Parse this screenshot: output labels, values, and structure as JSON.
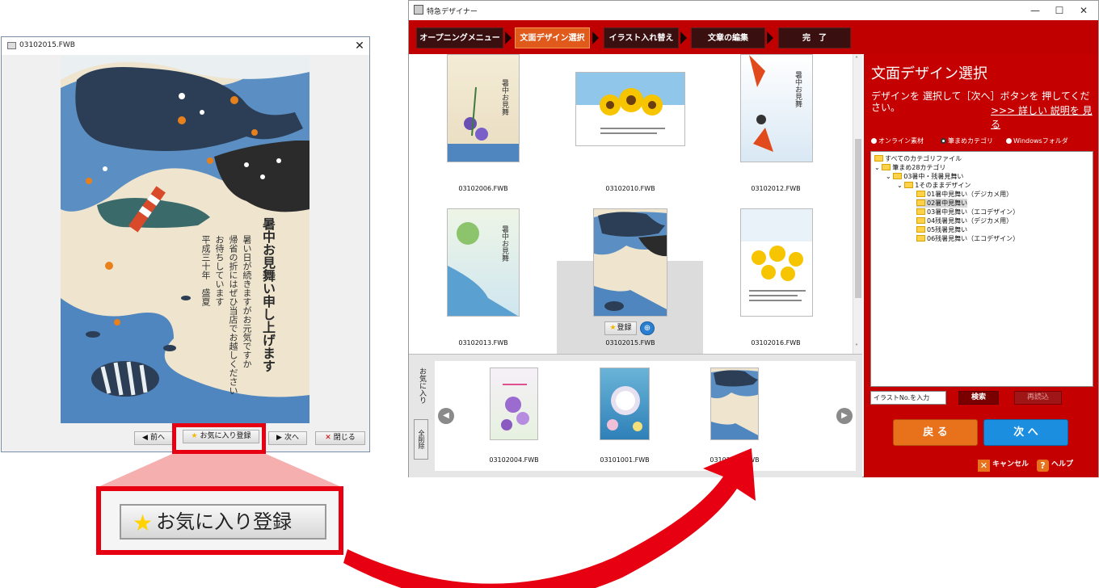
{
  "preview": {
    "title": "03102015.FWB",
    "close": "✕",
    "card_text": {
      "heading": "暑中お見舞い申し上げます",
      "body": [
        "暑い日が続きますがお元気ですか",
        "帰省の折にはぜひ当店でお越しください",
        "お待ちしています"
      ],
      "date": "平成三十年　盛夏"
    },
    "buttons": {
      "prev": "前へ",
      "favorite": "お気に入り登録",
      "next": "次へ",
      "close": "閉じる"
    }
  },
  "callout": {
    "label": "お気に入り登録"
  },
  "app": {
    "title": "特急デザイナー",
    "window_controls": {
      "minimize": "—",
      "maximize": "☐",
      "close": "✕"
    },
    "steps": [
      {
        "label": "オープニングメニュー",
        "active": false
      },
      {
        "label": "文面デザイン選択",
        "active": true
      },
      {
        "label": "イラスト入れ替え",
        "active": false
      },
      {
        "label": "文章の編集",
        "active": false
      },
      {
        "label": "完　了",
        "active": false
      }
    ],
    "thumbnails": [
      {
        "label": "03102006.FWB"
      },
      {
        "label": "03102010.FWB"
      },
      {
        "label": "03102012.FWB"
      },
      {
        "label": "03102013.FWB"
      },
      {
        "label": "03102015.FWB"
      },
      {
        "label": "03102016.FWB"
      }
    ],
    "register_button": "登録",
    "favorites": {
      "label": "お気に入り",
      "clear_all": "全削除",
      "items": [
        {
          "label": "03102004.FWB"
        },
        {
          "label": "03101001.FWB"
        },
        {
          "label": "03102015.FWB"
        }
      ]
    },
    "side": {
      "title": "文面デザイン選択",
      "description": "デザインを 選択して［次へ］ボタンを 押してください。",
      "more_link": ">>> 詳しい 説明を 見る",
      "radios": [
        {
          "label": "オンライン素材",
          "checked": false
        },
        {
          "label": "筆まめカテゴリ",
          "checked": true
        },
        {
          "label": "Windowsフォルダ",
          "checked": false
        }
      ],
      "tree": [
        {
          "label": "すべてのカテゴリファイル",
          "level": 0,
          "expander": "",
          "selected": false
        },
        {
          "label": "筆まめ28カテゴリ",
          "level": 1,
          "expander": "⌄",
          "selected": false
        },
        {
          "label": "03暑中・残暑見舞い",
          "level": 2,
          "expander": "⌄",
          "selected": false
        },
        {
          "label": "1そのままデザイン",
          "level": 3,
          "expander": "⌄",
          "selected": false
        },
        {
          "label": "01暑中見舞い（デジカメ用）",
          "level": 4,
          "expander": "",
          "selected": false
        },
        {
          "label": "02暑中見舞い",
          "level": 4,
          "expander": "",
          "selected": true
        },
        {
          "label": "03暑中見舞い（エコデザイン）",
          "level": 4,
          "expander": "",
          "selected": false
        },
        {
          "label": "04残暑見舞い（デジカメ用）",
          "level": 4,
          "expander": "",
          "selected": false
        },
        {
          "label": "05残暑見舞い",
          "level": 4,
          "expander": "",
          "selected": false
        },
        {
          "label": "06残暑見舞い（エコデザイン）",
          "level": 4,
          "expander": "",
          "selected": false
        }
      ],
      "search_value": "イラストNo.を入力",
      "search_button": "検索",
      "reload_button": "再読込",
      "back_button": "戻 る",
      "next_button": "次 へ",
      "cancel": "キャンセル",
      "help": "ヘルプ"
    }
  },
  "colors": {
    "accent_red": "#e60012",
    "panel_red": "#c40000",
    "active_step": "#e05a1c"
  }
}
